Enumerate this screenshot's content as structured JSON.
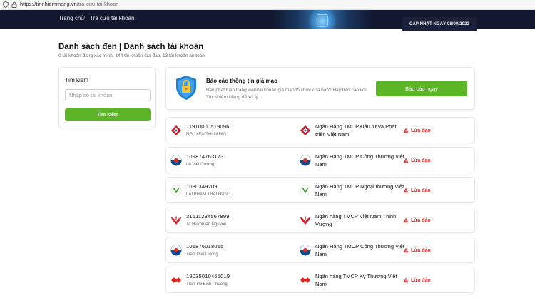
{
  "browser": {
    "url_host": "https://tinnhiemmang.vn",
    "url_path": "/tra-cuu-tai-khoan"
  },
  "header": {
    "breadcrumb_home": "Trang chủ",
    "breadcrumb_current": "Tra cứu tài khoản",
    "update_label": "CẬP NHẬT NGÀY 08/09/2022"
  },
  "page": {
    "title": "Danh sách đen | Danh sách tài khoản",
    "subtitle": "0 tài khoản đang xác minh, 144 tài khoản lừa đảo, 13 tài khoản an toàn"
  },
  "search": {
    "label": "Tìm kiếm",
    "placeholder": "Nhập số tài khoản",
    "button": "Tìm kiếm"
  },
  "report": {
    "title": "Báo cáo thông tin giả mạo",
    "description": "Bạn phát hiện trang web/tài khoản giả mạo tổ chức của bạn? Hãy báo cáo với Tín Nhiệm Mạng để xử lý",
    "button": "Báo cáo ngay"
  },
  "accounts": [
    {
      "number": "11910000519096",
      "owner": "NGUYEN THI DUNG",
      "bank": "Ngân Hàng TMCP Đầu tư và Phát triển Việt Nam",
      "bank_icon": "bidv-logo-icon",
      "status": "Lừa đảo"
    },
    {
      "number": "109874763173",
      "owner": "Lê Viết Cường",
      "bank": "Ngân Hàng TMCP Công Thương Việt Nam",
      "bank_icon": "vietinbank-logo-icon",
      "status": "Lừa đảo"
    },
    {
      "number": "1030349209",
      "owner": "LAI PHAM THAI HUNG",
      "bank": "Ngân Hàng TMCP Ngoại thương Việt Nam",
      "bank_icon": "vietcombank-logo-icon",
      "status": "Lừa đảo"
    },
    {
      "number": "31511234567899",
      "owner": "Ta Huynh An Nguyen",
      "bank": "Ngân hàng TMCP Việt Nam Thịnh Vượng",
      "bank_icon": "vpbank-logo-icon",
      "status": "Lừa đảo"
    },
    {
      "number": "101876018015",
      "owner": "Tran Thai Duong",
      "bank": "Ngân Hàng TMCP Công Thương Việt Nam",
      "bank_icon": "vietinbank-logo-icon",
      "status": "Lừa đảo"
    },
    {
      "number": "19035010465019",
      "owner": "Tran Thi Bich Phuong",
      "bank": "Ngân hàng TMCP Kỹ Thương Việt Nam",
      "bank_icon": "techcombank-logo-icon",
      "status": "Lừa đảo"
    }
  ],
  "colors": {
    "accent_green": "#5cb527",
    "danger_red": "#e03131",
    "banner_navy": "#12182f"
  }
}
